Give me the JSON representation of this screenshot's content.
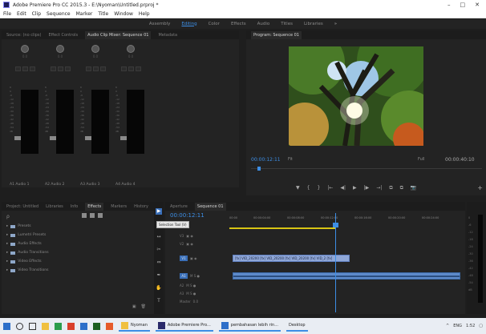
{
  "window": {
    "title": "Adobe Premiere Pro CC 2015.3 - E:\\Nyoman\\Untitled.prproj *",
    "controls": [
      "–",
      "□",
      "✕"
    ]
  },
  "menu": [
    "File",
    "Edit",
    "Clip",
    "Sequence",
    "Marker",
    "Title",
    "Window",
    "Help"
  ],
  "workspaces": {
    "items": [
      "Assembly",
      "Editing",
      "Color",
      "Effects",
      "Audio",
      "Titles",
      "Libraries"
    ],
    "active_index": 1,
    "more": "»"
  },
  "mixer_panel": {
    "tabs": [
      "Source: (no clips)",
      "Effect Controls",
      "Audio Clip Mixer: Sequence 01",
      "Metadata"
    ],
    "active_tab": 2,
    "channels": [
      {
        "label": "Audio 1",
        "code": "A1",
        "pan": "0.0"
      },
      {
        "label": "Audio 2",
        "code": "A2",
        "pan": "0.0"
      },
      {
        "label": "Audio 3",
        "code": "A3",
        "pan": "0.0"
      },
      {
        "label": "Audio 4",
        "code": "A4",
        "pan": "0.0"
      }
    ],
    "scale": [
      "6",
      "0",
      "-6",
      "-12",
      "-18",
      "-24",
      "-30",
      "-36",
      "-42",
      "-48",
      "-54",
      "dB"
    ],
    "fader_value": "0.0"
  },
  "program_monitor": {
    "tab": "Program: Sequence 01",
    "timecode_current": "00:00:12:11",
    "fit": "Fit",
    "resolution": "Full",
    "timecode_duration": "00:00:40:10",
    "transport": [
      "▼",
      "{",
      "}",
      "|←",
      "◀|",
      "▶",
      "|▶",
      "→|",
      "⧉",
      "⧉",
      "📷"
    ],
    "add_button": "+"
  },
  "effects_panel": {
    "tabs": [
      "Project: Untitled",
      "Libraries",
      "Info",
      "Effects",
      "Markers",
      "History"
    ],
    "active_tab": 3,
    "search_placeholder": "ρ",
    "items": [
      "Presets",
      "Lumetri Presets",
      "Audio Effects",
      "Audio Transitions",
      "Video Effects",
      "Video Transitions"
    ],
    "bottom_icons": [
      "▣",
      "🗑"
    ]
  },
  "tools": {
    "items": [
      "▶",
      "⇥",
      "↔",
      "✂",
      "⇔",
      "✒",
      "✋",
      "T"
    ],
    "tooltip": "Selection Tool (V)"
  },
  "timeline": {
    "tabs": [
      "Aperture",
      "Sequence 01"
    ],
    "active_tab": 1,
    "timecode": "00:00:12:11",
    "ruler": [
      "00:00",
      "00:00:04:00",
      "00:00:08:00",
      "00:00:12:00",
      "00:00:16:00",
      "00:00:20:00",
      "00:00:24:00"
    ],
    "tracks": [
      {
        "name": "V3",
        "target": false
      },
      {
        "name": "V2",
        "target": false
      },
      {
        "name": "V1",
        "target": true
      },
      {
        "name": "A1",
        "target": true
      },
      {
        "name": "A2",
        "target": false
      },
      {
        "name": "A3",
        "target": false
      }
    ],
    "master": "Master",
    "master_value": "0.0",
    "video_clip_label": "[fx] VID_20200 [fx] VID_20200 [fx] VID_20200 [fx] VID_2 [fx]"
  },
  "audio_meter": {
    "scale": [
      "0",
      "-6",
      "-12",
      "-18",
      "-24",
      "-30",
      "-36",
      "-42",
      "-48",
      "-54",
      "dB"
    ]
  },
  "taskbar": {
    "tasks": [
      "Nyoman",
      "Adobe Premiere Pro...",
      "pembahasan lebih rin...",
      "Desktop"
    ],
    "tray": [
      "^",
      "ENG",
      "1:52",
      "▢"
    ]
  }
}
